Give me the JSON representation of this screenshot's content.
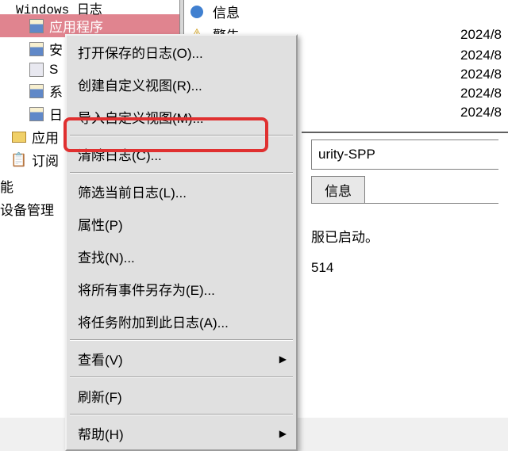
{
  "top_fragment": "日志",
  "sidebar": {
    "items": [
      {
        "label": "应用程序",
        "selected": true
      },
      {
        "label": "安"
      },
      {
        "label": "S"
      },
      {
        "label": "系"
      },
      {
        "label": "日"
      }
    ],
    "plain": [
      {
        "label": "应用"
      },
      {
        "label": "订阅"
      }
    ],
    "bottom": [
      {
        "label": "能"
      },
      {
        "label": "设备管理"
      }
    ]
  },
  "events": [
    {
      "level_icon": "info",
      "level": "信息",
      "date": "2024/8"
    },
    {
      "level_icon": "warn",
      "level": "警告",
      "date": ""
    },
    {
      "level_icon": "",
      "level": "",
      "date": "2024/8"
    },
    {
      "level_icon": "",
      "level": "",
      "date": "2024/8"
    },
    {
      "level_icon": "",
      "level": "",
      "date": "2024/8"
    },
    {
      "level_icon": "",
      "level": "",
      "date": "2024/8"
    }
  ],
  "detail": {
    "source_fragment": "urity-SPP",
    "button_label": "信息",
    "message": "服已启动。",
    "number": "514"
  },
  "menu": {
    "items": [
      {
        "label": "打开保存的日志(O)...",
        "sep": false,
        "arrow": false
      },
      {
        "label": "创建自定义视图(R)...",
        "sep": false,
        "arrow": false
      },
      {
        "label": "导入自定义视图(M)...",
        "sep": true,
        "arrow": false
      },
      {
        "label": "清除日志(C)...",
        "sep": true,
        "arrow": false,
        "highlighted": true
      },
      {
        "label": "筛选当前日志(L)...",
        "sep": false,
        "arrow": false
      },
      {
        "label": "属性(P)",
        "sep": false,
        "arrow": false
      },
      {
        "label": "查找(N)...",
        "sep": false,
        "arrow": false
      },
      {
        "label": "将所有事件另存为(E)...",
        "sep": false,
        "arrow": false
      },
      {
        "label": "将任务附加到此日志(A)...",
        "sep": true,
        "arrow": false
      },
      {
        "label": "查看(V)",
        "sep": true,
        "arrow": true
      },
      {
        "label": "刷新(F)",
        "sep": true,
        "arrow": false
      },
      {
        "label": "帮助(H)",
        "sep": false,
        "arrow": true
      }
    ]
  }
}
